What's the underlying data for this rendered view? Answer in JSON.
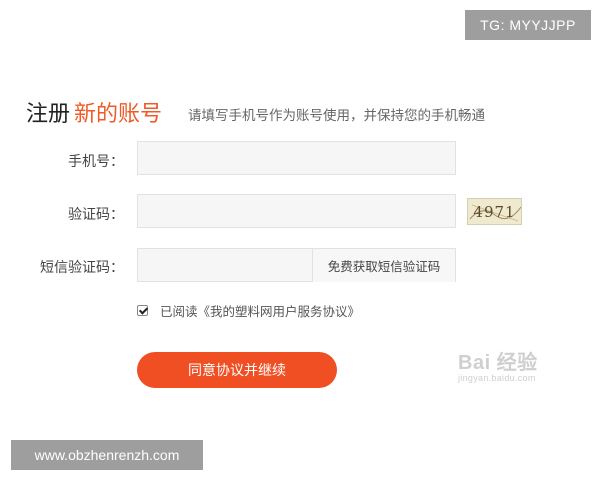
{
  "overlays": {
    "tg_label": "TG: MYYJJPP",
    "url_label": "www.obzhenrenzh.com",
    "watermark_main": "Bai 经验",
    "watermark_sub": "jingyan.baidu.com"
  },
  "header": {
    "title_prefix": "注册",
    "title_highlight": "新的账号",
    "subtitle": "请填写手机号作为账号使用，并保持您的手机畅通"
  },
  "form": {
    "phone": {
      "label": "手机号：",
      "value": "",
      "placeholder": ""
    },
    "captcha": {
      "label": "验证码：",
      "value": "",
      "placeholder": "",
      "image_text": "4971"
    },
    "sms": {
      "label": "短信验证码：",
      "value": "",
      "placeholder": "",
      "button_label": "免费获取短信验证码"
    },
    "agreement": {
      "checked": true,
      "text": "已阅读《我的塑料网用户服务协议》"
    },
    "submit_label": "同意协议并继续"
  },
  "colors": {
    "accent": "#f05a28",
    "button": "#f04e23",
    "field_bg": "#f6f6f6",
    "overlay_bg": "#9e9e9e"
  }
}
